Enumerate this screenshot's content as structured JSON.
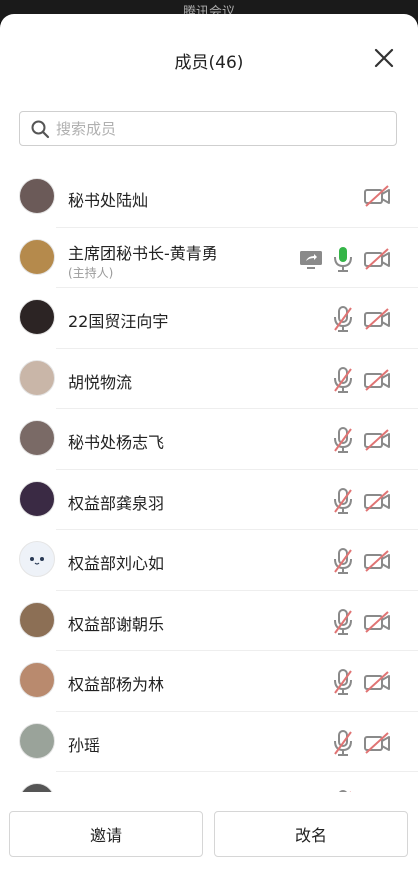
{
  "top_bar": {
    "title": "腾讯会议"
  },
  "header": {
    "title": "成员(46)"
  },
  "search": {
    "placeholder": "搜索成员",
    "value": ""
  },
  "members": [
    {
      "name": "秘书处陆灿",
      "sub": "",
      "mic": "none",
      "share": false,
      "avatar_color": "#6b5a58"
    },
    {
      "name": "主席团秘书长-黄青勇",
      "sub": "(主持人)",
      "mic": "on",
      "share": true,
      "avatar_color": "#b58a4c"
    },
    {
      "name": "22国贸汪向宇",
      "sub": "",
      "mic": "muted",
      "share": false,
      "avatar_color": "#2c2424"
    },
    {
      "name": "胡悦物流",
      "sub": "",
      "mic": "muted",
      "share": false,
      "avatar_color": "#c9b6a8"
    },
    {
      "name": "秘书处杨志飞",
      "sub": "",
      "mic": "muted",
      "share": false,
      "avatar_color": "#7a6a66"
    },
    {
      "name": "权益部龚泉羽",
      "sub": "",
      "mic": "muted",
      "share": false,
      "avatar_color": "#3a2a44"
    },
    {
      "name": "权益部刘心如",
      "sub": "",
      "mic": "muted",
      "share": false,
      "avatar_color": "#eef2f8"
    },
    {
      "name": "权益部谢朝乐",
      "sub": "",
      "mic": "muted",
      "share": false,
      "avatar_color": "#8c6f55"
    },
    {
      "name": "权益部杨为林",
      "sub": "",
      "mic": "muted",
      "share": false,
      "avatar_color": "#b98a6e"
    },
    {
      "name": "孙瑶",
      "sub": "",
      "mic": "muted",
      "share": false,
      "avatar_color": "#9aa39a"
    },
    {
      "name": "",
      "sub": "",
      "mic": "muted",
      "share": false,
      "avatar_color": "#555555"
    }
  ],
  "colors": {
    "mic_on": "#35b548",
    "muted_slash": "#e07474",
    "icon_gray": "#8a8a8a"
  },
  "footer": {
    "invite_label": "邀请",
    "rename_label": "改名"
  }
}
